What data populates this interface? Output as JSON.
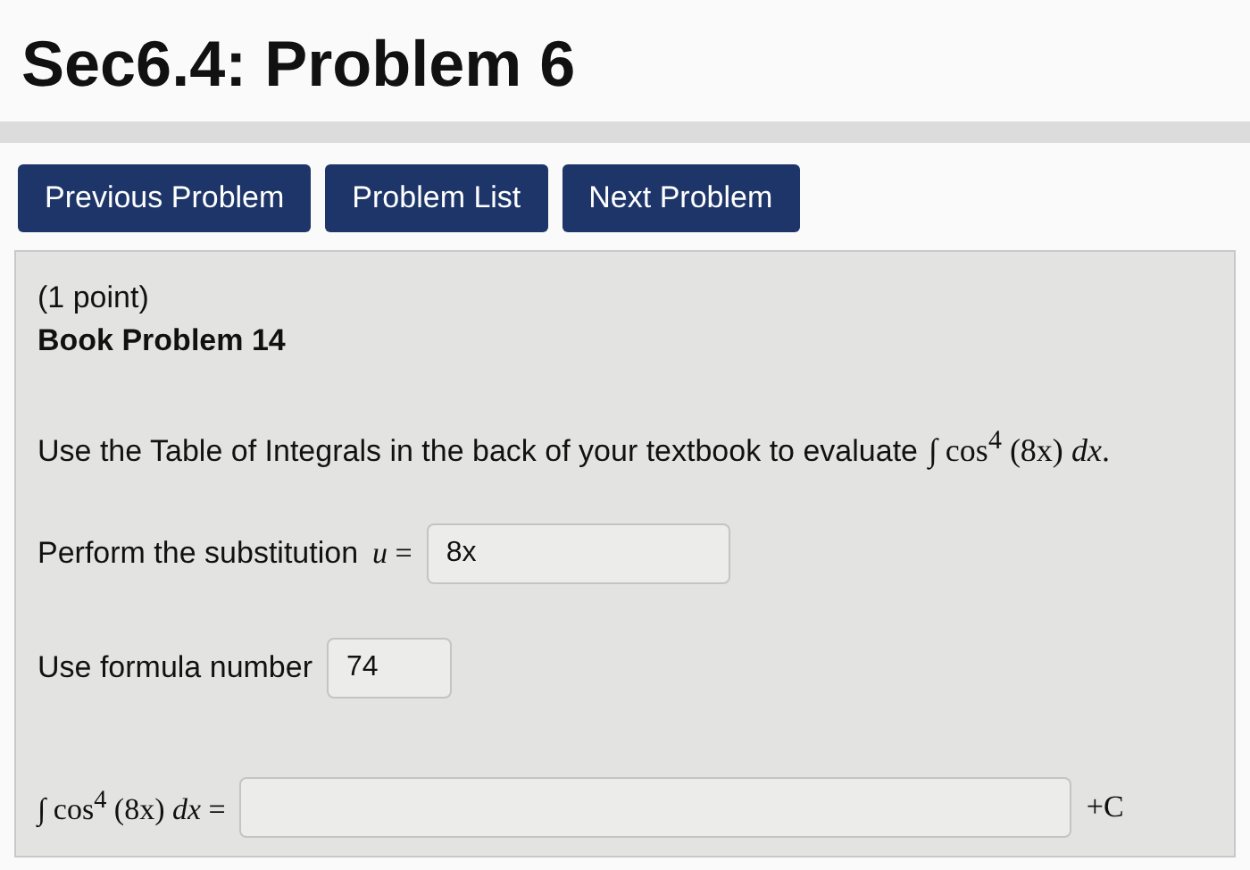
{
  "page_title": "Sec6.4: Problem 6",
  "nav_buttons": [
    {
      "label": "Previous Problem"
    },
    {
      "label": "Problem List"
    },
    {
      "label": "Next Problem"
    }
  ],
  "problem": {
    "points": "(1 point)",
    "source": "Book Problem 14",
    "statement": "Use the Table of Integrals in the back of your textbook to evaluate",
    "statement_math": "∫ cos$^{4}$ (8x) *dx*.",
    "fields": [
      {
        "label": "Perform the substitution",
        "math": "*u* =",
        "value": "8x"
      },
      {
        "label": "Use formula number",
        "value": "74"
      },
      {
        "math": "∫ cos$^{4}$ (8x) *dx* =",
        "suffix": "+C"
      }
    ]
  }
}
